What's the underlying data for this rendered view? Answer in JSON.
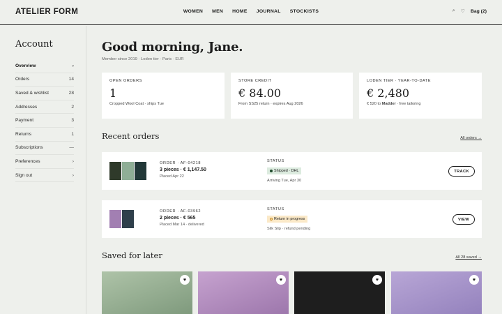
{
  "brand": "ATELIER FORM",
  "nav": [
    "WOMEN",
    "MEN",
    "HOME",
    "JOURNAL",
    "STOCKISTS"
  ],
  "header_right": {
    "search_icon": "⌕",
    "wishlist_icon": "♡",
    "bag_label": "Bag (2)"
  },
  "sidebar": {
    "title": "Account",
    "items": [
      {
        "label": "Overview",
        "count": "›",
        "active": true
      },
      {
        "label": "Orders",
        "count": "14"
      },
      {
        "label": "Saved & wishlist",
        "count": "28"
      },
      {
        "label": "Addresses",
        "count": "2"
      },
      {
        "label": "Payment",
        "count": "3"
      },
      {
        "label": "Returns",
        "count": "1"
      },
      {
        "label": "Subscriptions",
        "count": "—"
      },
      {
        "label": "Preferences",
        "count": "›"
      },
      {
        "label": "Sign out",
        "count": "›"
      }
    ]
  },
  "greeting": "Good morning, Jane.",
  "member_line": "Member since 2019 · Loden tier · Paris · EUR",
  "stats": [
    {
      "label": "OPEN ORDERS",
      "value": "1",
      "note": "Cropped Wool Coat · ships Tue"
    },
    {
      "label": "STORE CREDIT",
      "value": "€ 84.00",
      "note": "From SS25 return · expires Aug 2026"
    },
    {
      "label": "LODEN TIER · YEAR-TO-DATE",
      "value": "€ 2,480",
      "note_pre": "€ 520 to ",
      "note_bold": "Madder",
      "note_post": " · free tailoring"
    }
  ],
  "recent_orders": {
    "title": "Recent orders",
    "link": "All orders →",
    "orders": [
      {
        "id": "ORDER · AF-04218",
        "summary": "3 pieces · € 1,147.50",
        "date": "Placed Apr 22",
        "status_label": "STATUS",
        "badge": "Shipped · DHL",
        "badge_bg": "#dcebdf",
        "badge_dot": "#1f4a2c",
        "status_note": "Arriving Tue, Apr 30",
        "button": "TRACK",
        "thumbs": [
          "#2f3a2a",
          "#8fae96",
          "#223838"
        ]
      },
      {
        "id": "ORDER · AF-03962",
        "summary": "2 pieces · € 565",
        "date": "Placed Mar 14 · delivered",
        "status_label": "STATUS",
        "badge": "Return in progress",
        "badge_bg": "#fbe9c8",
        "badge_dot": "#c98a1a",
        "status_note": "Silk Slip · refund pending",
        "button": "VIEW",
        "thumbs": [
          "#a27fb2",
          "#2f3f4b"
        ]
      }
    ]
  },
  "saved": {
    "title": "Saved for later",
    "link": "All 28 saved →",
    "tiles": [
      {
        "color": "#9db59a",
        "heart": "♥"
      },
      {
        "color": "#b790bf",
        "heart": "♥"
      },
      {
        "color": "#1d1d1d",
        "heart": "♥"
      },
      {
        "color": "#a895c9",
        "heart": "♥"
      }
    ]
  }
}
